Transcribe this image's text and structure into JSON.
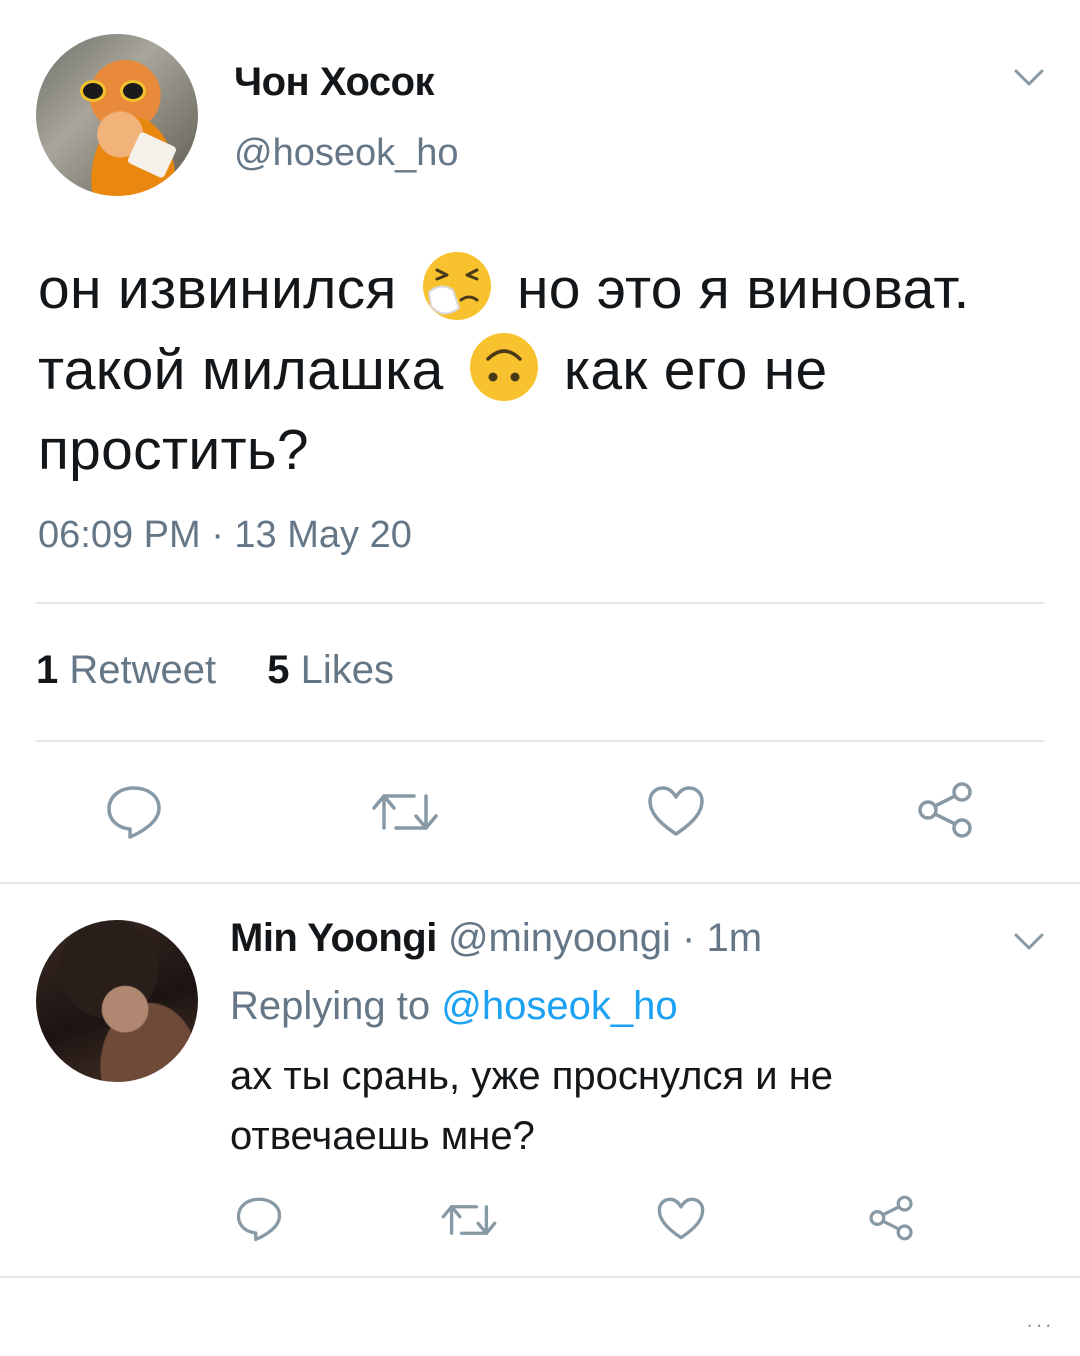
{
  "tweet": {
    "author_name": "Чон Хосок",
    "author_handle": "@hoseok_ho",
    "text_part1": "он извинился",
    "emoji1": "sneezing-face-emoji",
    "text_part2": "но это я виноват. такой милашка",
    "emoji2": "upside-down-face-emoji",
    "text_part3": "как его не простить?",
    "timestamp": "06:09 PM · 13 May 20",
    "retweet_count": "1",
    "retweet_label": "Retweet",
    "like_count": "5",
    "like_label": "Likes",
    "actions": [
      "reply-icon",
      "retweet-icon",
      "like-icon",
      "share-icon"
    ]
  },
  "reply": {
    "author_name": "Min Yoongi",
    "author_handle": "@minyoongi",
    "time_ago": "1m",
    "replying_prefix": "Replying to",
    "replying_to": "@hoseok_ho",
    "text": "ах ты срань, уже проснулся и не отвечаешь мне?",
    "actions": [
      "reply-icon",
      "retweet-icon",
      "like-icon",
      "share-icon"
    ]
  },
  "colors": {
    "text": "#14171a",
    "secondary": "#657786",
    "link": "#1da1f2",
    "divider": "#e1e8ed",
    "emoji_yellow": "#f7c22e"
  },
  "footer": {
    "overflow_icon": "ellipsis-icon"
  }
}
